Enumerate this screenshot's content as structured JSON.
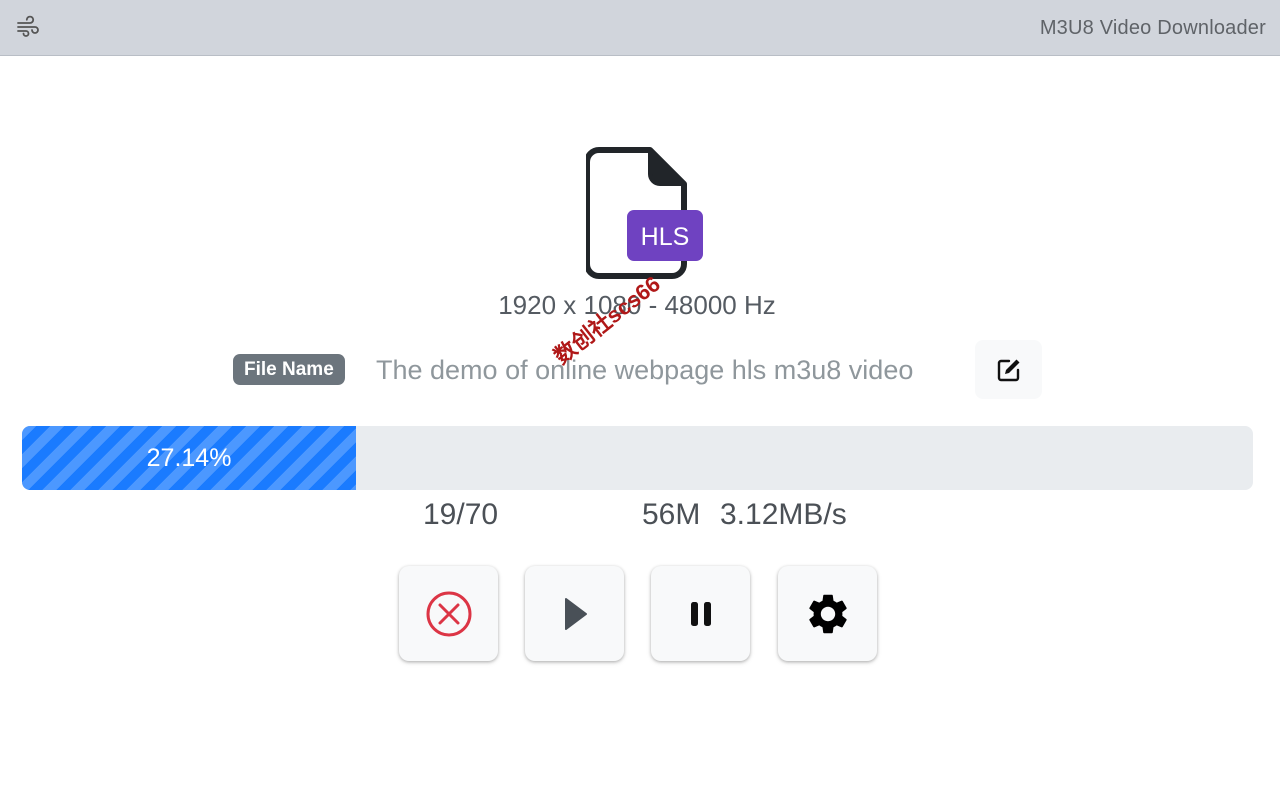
{
  "header": {
    "app_title": "M3U8 Video Downloader",
    "menu_icon": "wind-icon"
  },
  "file": {
    "icon": "hls-file-icon",
    "format_label": "HLS",
    "format_color": "#6f42c1",
    "meta": "1920 x 1080 - 48000 Hz",
    "name_label": "File Name",
    "name_value": "The demo of online webpage hls m3u8 video"
  },
  "progress": {
    "percent": 27.14,
    "percent_label": "27.14%",
    "segments": "19/70",
    "size": "56M",
    "speed": "3.12MB/s",
    "bar_color": "#1a7bff"
  },
  "controls": {
    "cancel_icon": "cancel-circle-icon",
    "play_icon": "play-icon",
    "pause_icon": "pause-icon",
    "settings_icon": "gear-icon",
    "cancel_color": "#dc3545"
  },
  "watermark": "数创社scs66"
}
